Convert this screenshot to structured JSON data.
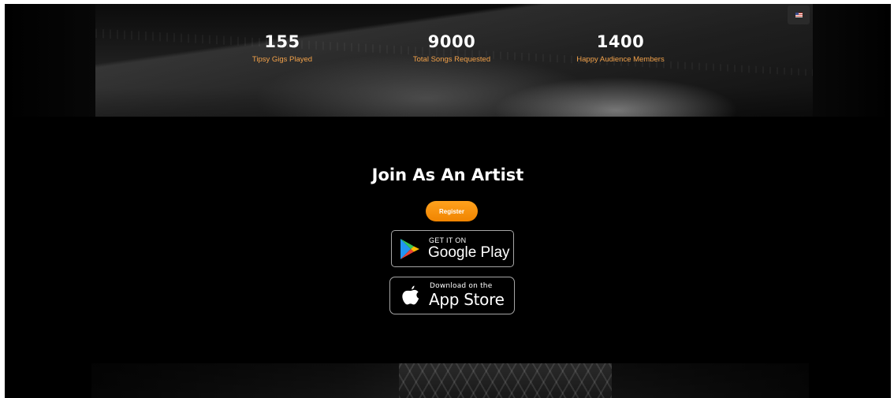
{
  "stats": [
    {
      "value": "155",
      "label": "Tipsy Gigs Played"
    },
    {
      "value": "9000",
      "label": "Total Songs Requested"
    },
    {
      "value": "1400",
      "label": "Happy Audience Members"
    }
  ],
  "language": {
    "icon": "us-flag-icon"
  },
  "join": {
    "title": "Join As An Artist",
    "register_label": "Register"
  },
  "stores": {
    "google_play": {
      "small": "GET IT ON",
      "big": "Google Play",
      "icon": "google-play-icon"
    },
    "app_store": {
      "small": "Download on the",
      "big": "App Store",
      "icon": "apple-icon"
    }
  },
  "colors": {
    "accent": "#f3a24a",
    "register_bg": "#f59200",
    "background": "#000000"
  }
}
